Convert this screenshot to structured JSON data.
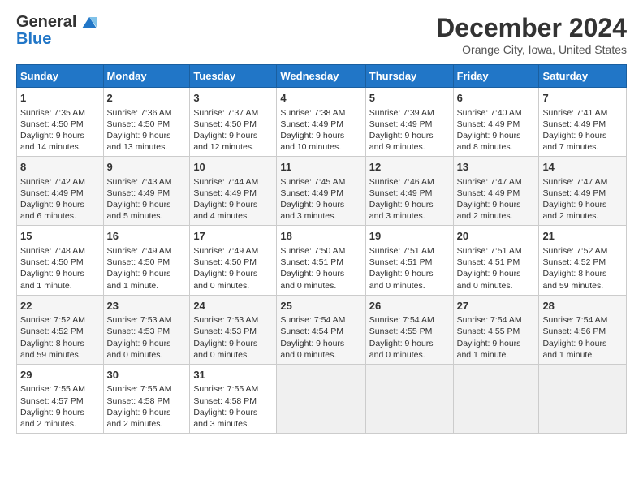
{
  "header": {
    "logo_line1": "General",
    "logo_line2": "Blue",
    "title": "December 2024",
    "subtitle": "Orange City, Iowa, United States"
  },
  "columns": [
    "Sunday",
    "Monday",
    "Tuesday",
    "Wednesday",
    "Thursday",
    "Friday",
    "Saturday"
  ],
  "weeks": [
    [
      {
        "day": "1",
        "lines": [
          "Sunrise: 7:35 AM",
          "Sunset: 4:50 PM",
          "Daylight: 9 hours",
          "and 14 minutes."
        ]
      },
      {
        "day": "2",
        "lines": [
          "Sunrise: 7:36 AM",
          "Sunset: 4:50 PM",
          "Daylight: 9 hours",
          "and 13 minutes."
        ]
      },
      {
        "day": "3",
        "lines": [
          "Sunrise: 7:37 AM",
          "Sunset: 4:50 PM",
          "Daylight: 9 hours",
          "and 12 minutes."
        ]
      },
      {
        "day": "4",
        "lines": [
          "Sunrise: 7:38 AM",
          "Sunset: 4:49 PM",
          "Daylight: 9 hours",
          "and 10 minutes."
        ]
      },
      {
        "day": "5",
        "lines": [
          "Sunrise: 7:39 AM",
          "Sunset: 4:49 PM",
          "Daylight: 9 hours",
          "and 9 minutes."
        ]
      },
      {
        "day": "6",
        "lines": [
          "Sunrise: 7:40 AM",
          "Sunset: 4:49 PM",
          "Daylight: 9 hours",
          "and 8 minutes."
        ]
      },
      {
        "day": "7",
        "lines": [
          "Sunrise: 7:41 AM",
          "Sunset: 4:49 PM",
          "Daylight: 9 hours",
          "and 7 minutes."
        ]
      }
    ],
    [
      {
        "day": "8",
        "lines": [
          "Sunrise: 7:42 AM",
          "Sunset: 4:49 PM",
          "Daylight: 9 hours",
          "and 6 minutes."
        ]
      },
      {
        "day": "9",
        "lines": [
          "Sunrise: 7:43 AM",
          "Sunset: 4:49 PM",
          "Daylight: 9 hours",
          "and 5 minutes."
        ]
      },
      {
        "day": "10",
        "lines": [
          "Sunrise: 7:44 AM",
          "Sunset: 4:49 PM",
          "Daylight: 9 hours",
          "and 4 minutes."
        ]
      },
      {
        "day": "11",
        "lines": [
          "Sunrise: 7:45 AM",
          "Sunset: 4:49 PM",
          "Daylight: 9 hours",
          "and 3 minutes."
        ]
      },
      {
        "day": "12",
        "lines": [
          "Sunrise: 7:46 AM",
          "Sunset: 4:49 PM",
          "Daylight: 9 hours",
          "and 3 minutes."
        ]
      },
      {
        "day": "13",
        "lines": [
          "Sunrise: 7:47 AM",
          "Sunset: 4:49 PM",
          "Daylight: 9 hours",
          "and 2 minutes."
        ]
      },
      {
        "day": "14",
        "lines": [
          "Sunrise: 7:47 AM",
          "Sunset: 4:49 PM",
          "Daylight: 9 hours",
          "and 2 minutes."
        ]
      }
    ],
    [
      {
        "day": "15",
        "lines": [
          "Sunrise: 7:48 AM",
          "Sunset: 4:50 PM",
          "Daylight: 9 hours",
          "and 1 minute."
        ]
      },
      {
        "day": "16",
        "lines": [
          "Sunrise: 7:49 AM",
          "Sunset: 4:50 PM",
          "Daylight: 9 hours",
          "and 1 minute."
        ]
      },
      {
        "day": "17",
        "lines": [
          "Sunrise: 7:49 AM",
          "Sunset: 4:50 PM",
          "Daylight: 9 hours",
          "and 0 minutes."
        ]
      },
      {
        "day": "18",
        "lines": [
          "Sunrise: 7:50 AM",
          "Sunset: 4:51 PM",
          "Daylight: 9 hours",
          "and 0 minutes."
        ]
      },
      {
        "day": "19",
        "lines": [
          "Sunrise: 7:51 AM",
          "Sunset: 4:51 PM",
          "Daylight: 9 hours",
          "and 0 minutes."
        ]
      },
      {
        "day": "20",
        "lines": [
          "Sunrise: 7:51 AM",
          "Sunset: 4:51 PM",
          "Daylight: 9 hours",
          "and 0 minutes."
        ]
      },
      {
        "day": "21",
        "lines": [
          "Sunrise: 7:52 AM",
          "Sunset: 4:52 PM",
          "Daylight: 8 hours",
          "and 59 minutes."
        ]
      }
    ],
    [
      {
        "day": "22",
        "lines": [
          "Sunrise: 7:52 AM",
          "Sunset: 4:52 PM",
          "Daylight: 8 hours",
          "and 59 minutes."
        ]
      },
      {
        "day": "23",
        "lines": [
          "Sunrise: 7:53 AM",
          "Sunset: 4:53 PM",
          "Daylight: 9 hours",
          "and 0 minutes."
        ]
      },
      {
        "day": "24",
        "lines": [
          "Sunrise: 7:53 AM",
          "Sunset: 4:53 PM",
          "Daylight: 9 hours",
          "and 0 minutes."
        ]
      },
      {
        "day": "25",
        "lines": [
          "Sunrise: 7:54 AM",
          "Sunset: 4:54 PM",
          "Daylight: 9 hours",
          "and 0 minutes."
        ]
      },
      {
        "day": "26",
        "lines": [
          "Sunrise: 7:54 AM",
          "Sunset: 4:55 PM",
          "Daylight: 9 hours",
          "and 0 minutes."
        ]
      },
      {
        "day": "27",
        "lines": [
          "Sunrise: 7:54 AM",
          "Sunset: 4:55 PM",
          "Daylight: 9 hours",
          "and 1 minute."
        ]
      },
      {
        "day": "28",
        "lines": [
          "Sunrise: 7:54 AM",
          "Sunset: 4:56 PM",
          "Daylight: 9 hours",
          "and 1 minute."
        ]
      }
    ],
    [
      {
        "day": "29",
        "lines": [
          "Sunrise: 7:55 AM",
          "Sunset: 4:57 PM",
          "Daylight: 9 hours",
          "and 2 minutes."
        ]
      },
      {
        "day": "30",
        "lines": [
          "Sunrise: 7:55 AM",
          "Sunset: 4:58 PM",
          "Daylight: 9 hours",
          "and 2 minutes."
        ]
      },
      {
        "day": "31",
        "lines": [
          "Sunrise: 7:55 AM",
          "Sunset: 4:58 PM",
          "Daylight: 9 hours",
          "and 3 minutes."
        ]
      },
      {
        "day": "",
        "lines": []
      },
      {
        "day": "",
        "lines": []
      },
      {
        "day": "",
        "lines": []
      },
      {
        "day": "",
        "lines": []
      }
    ]
  ]
}
